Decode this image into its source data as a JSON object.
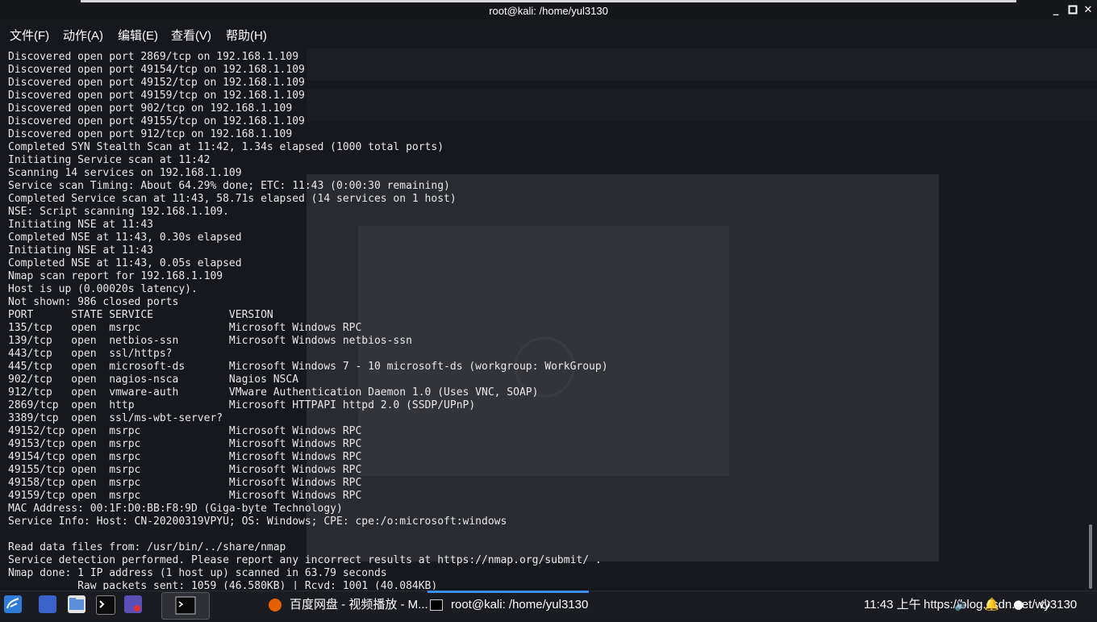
{
  "window": {
    "title": "root@kali: /home/yul3130"
  },
  "menu": [
    "文件(F)",
    "动作(A)",
    "编辑(E)",
    "查看(V)",
    "帮助(H)"
  ],
  "terminal_lines": [
    "Discovered open port 2869/tcp on 192.168.1.109",
    "Discovered open port 49154/tcp on 192.168.1.109",
    "Discovered open port 49152/tcp on 192.168.1.109",
    "Discovered open port 49159/tcp on 192.168.1.109",
    "Discovered open port 902/tcp on 192.168.1.109",
    "Discovered open port 49155/tcp on 192.168.1.109",
    "Discovered open port 912/tcp on 192.168.1.109",
    "Completed SYN Stealth Scan at 11:42, 1.34s elapsed (1000 total ports)",
    "Initiating Service scan at 11:42",
    "Scanning 14 services on 192.168.1.109",
    "Service scan Timing: About 64.29% done; ETC: 11:43 (0:00:30 remaining)",
    "Completed Service scan at 11:43, 58.71s elapsed (14 services on 1 host)",
    "NSE: Script scanning 192.168.1.109.",
    "Initiating NSE at 11:43",
    "Completed NSE at 11:43, 0.30s elapsed",
    "Initiating NSE at 11:43",
    "Completed NSE at 11:43, 0.05s elapsed",
    "Nmap scan report for 192.168.1.109",
    "Host is up (0.00020s latency).",
    "Not shown: 986 closed ports",
    "PORT      STATE SERVICE            VERSION",
    "135/tcp   open  msrpc              Microsoft Windows RPC",
    "139/tcp   open  netbios-ssn        Microsoft Windows netbios-ssn",
    "443/tcp   open  ssl/https?",
    "445/tcp   open  microsoft-ds       Microsoft Windows 7 - 10 microsoft-ds (workgroup: WorkGroup)",
    "902/tcp   open  nagios-nsca        Nagios NSCA",
    "912/tcp   open  vmware-auth        VMware Authentication Daemon 1.0 (Uses VNC, SOAP)",
    "2869/tcp  open  http               Microsoft HTTPAPI httpd 2.0 (SSDP/UPnP)",
    "3389/tcp  open  ssl/ms-wbt-server?",
    "49152/tcp open  msrpc              Microsoft Windows RPC",
    "49153/tcp open  msrpc              Microsoft Windows RPC",
    "49154/tcp open  msrpc              Microsoft Windows RPC",
    "49155/tcp open  msrpc              Microsoft Windows RPC",
    "49158/tcp open  msrpc              Microsoft Windows RPC",
    "49159/tcp open  msrpc              Microsoft Windows RPC",
    "MAC Address: 00:1F:D0:BB:F8:9D (Giga-byte Technology)",
    "Service Info: Host: CN-20200319VPYU; OS: Windows; CPE: cpe:/o:microsoft:windows",
    "",
    "Read data files from: /usr/bin/../share/nmap",
    "Service detection performed. Please report any incorrect results at https://nmap.org/submit/ .",
    "Nmap done: 1 IP address (1 host up) scanned in 63.79 seconds",
    "           Raw packets sent: 1059 (46.580KB) | Rcvd: 1001 (40.084KB)"
  ],
  "taskbar": {
    "tasks": [
      {
        "label": "百度网盘 - 视频播放 - M..."
      },
      {
        "label": "root@kali: /home/yul3130"
      }
    ],
    "clock": "11:43 上午",
    "tray_text": "https://blog.csdn.net/wy3130"
  }
}
